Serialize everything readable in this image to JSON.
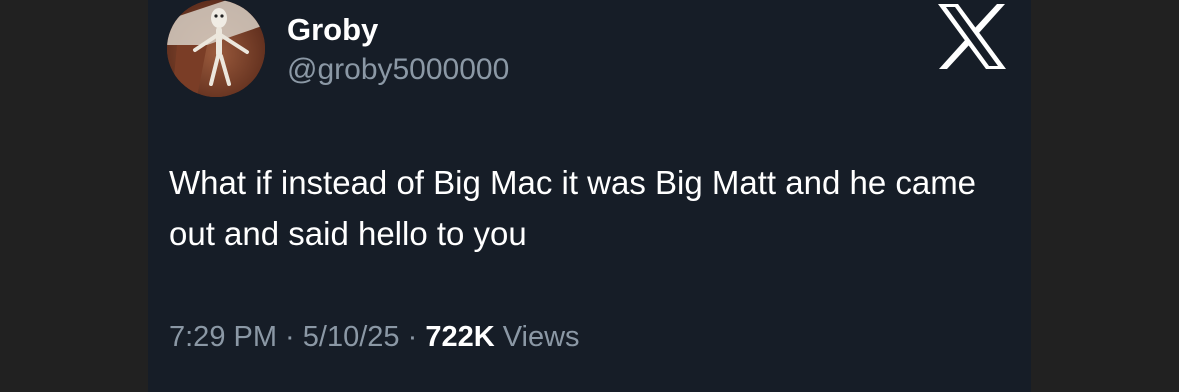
{
  "author": {
    "name": "Groby",
    "handle": "@groby5000000"
  },
  "tweet": {
    "text": "What if instead of Big Mac it was Big Matt and he came out and said hello to you"
  },
  "meta": {
    "time": "7:29 PM",
    "separator": " · ",
    "date": "5/10/25",
    "views_count": "722K",
    "views_label": "Views"
  },
  "icons": {
    "brand": "x-logo-icon",
    "avatar": "avatar-image"
  },
  "colors": {
    "page_background": "#212121",
    "card_background": "#161d27",
    "primary_text": "#ffffff",
    "secondary_text": "#8b98a5"
  }
}
